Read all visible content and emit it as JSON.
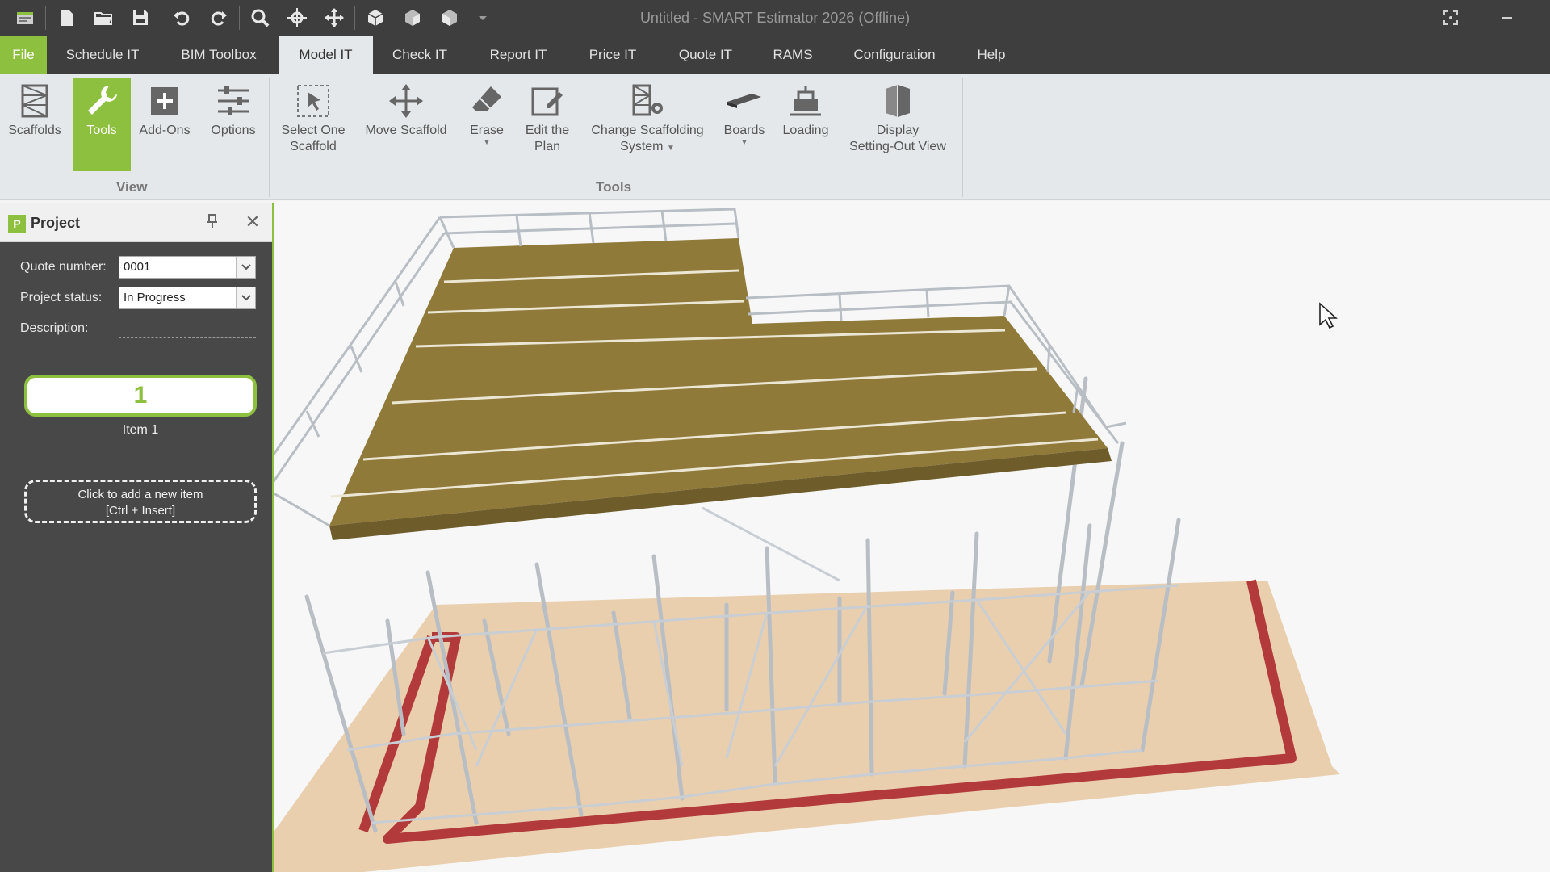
{
  "window": {
    "title": "Untitled - SMART Estimator 2026 (Offline)"
  },
  "quick_access": [
    {
      "name": "app-icon"
    },
    {
      "name": "new-file-icon"
    },
    {
      "name": "open-folder-icon"
    },
    {
      "name": "save-icon"
    },
    {
      "name": "undo-icon"
    },
    {
      "name": "redo-icon"
    },
    {
      "name": "zoom-icon"
    },
    {
      "name": "orbit-icon"
    },
    {
      "name": "pan-icon"
    },
    {
      "name": "view-cube-front-icon"
    },
    {
      "name": "view-cube-side-icon"
    },
    {
      "name": "view-cube-iso-icon"
    },
    {
      "name": "customize-dropdown-icon"
    }
  ],
  "menu": {
    "tabs": [
      "File",
      "Schedule IT",
      "BIM Toolbox",
      "Model IT",
      "Check IT",
      "Report IT",
      "Price IT",
      "Quote IT",
      "RAMS",
      "Configuration",
      "Help"
    ],
    "active": "Model IT"
  },
  "ribbon": {
    "view_group": "View",
    "tools_group": "Tools",
    "buttons": {
      "scaffolds": "Scaffolds",
      "tools": "Tools",
      "addons": "Add-Ons",
      "options": "Options",
      "select_one_1": "Select One",
      "select_one_2": "Scaffold",
      "move_scaffold": "Move Scaffold",
      "erase": "Erase",
      "edit_plan_1": "Edit the",
      "edit_plan_2": "Plan",
      "change_system_1": "Change Scaffolding",
      "change_system_2": "System",
      "boards": "Boards",
      "loading": "Loading",
      "display_1": "Display",
      "display_2": "Setting-Out View"
    }
  },
  "project_panel": {
    "title": "Project",
    "quote_number_label": "Quote number:",
    "quote_number_value": "0001",
    "project_status_label": "Project status:",
    "project_status_value": "In Progress",
    "description_label": "Description:",
    "item_number": "1",
    "item_label": "Item 1",
    "add_item_line1": "Click to add a new item",
    "add_item_line2": "[Ctrl + Insert]"
  },
  "colors": {
    "accent": "#8dc03f",
    "titlebar": "#3e3e3e",
    "ribbon": "#e4e8ea",
    "deck": "#8f7a3a",
    "footprint": "#b23a3a",
    "ground": "#e9cfae"
  }
}
